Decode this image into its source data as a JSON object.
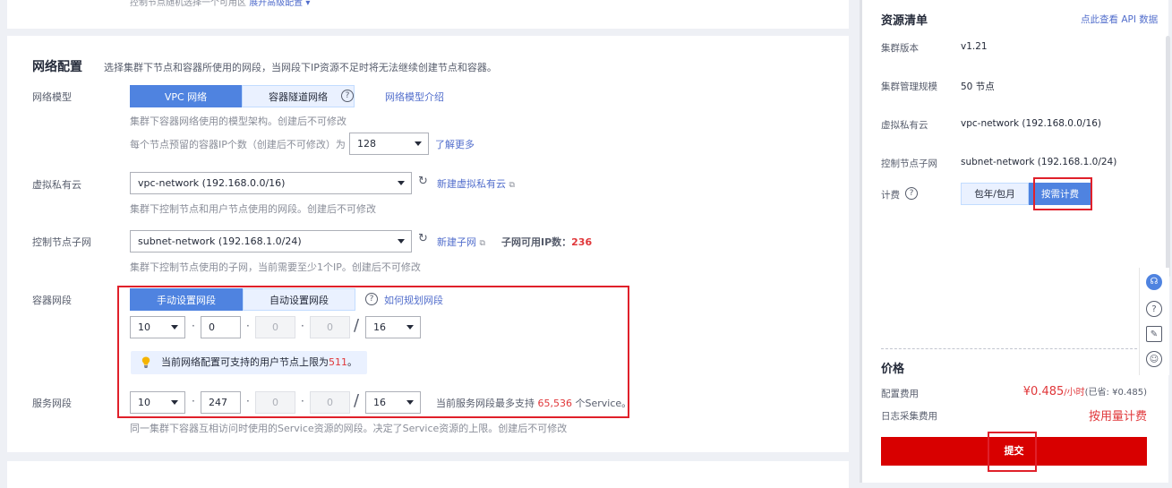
{
  "top": {
    "hint": "控制节点随机选择一个可用区",
    "advanced_link": "展开高级配置"
  },
  "network": {
    "title": "网络配置",
    "desc": "选择集群下节点和容器所使用的网段，当网段下IP资源不足时将无法继续创建节点和容器。",
    "model": {
      "label": "网络模型",
      "options": [
        "VPC 网络",
        "容器隧道网络"
      ],
      "selected": "VPC 网络",
      "help_link": "网络模型介绍",
      "help1": "集群下容器网络使用的模型架构。创建后不可修改",
      "help2": "每个节点预留的容器IP个数（创建后不可修改）为",
      "ip_count": "128",
      "more_link": "了解更多"
    },
    "vpc": {
      "label": "虚拟私有云",
      "value": "vpc-network (192.168.0.0/16)",
      "new_link": "新建虚拟私有云",
      "help": "集群下控制节点和用户节点使用的网段。创建后不可修改"
    },
    "subnet": {
      "label": "控制节点子网",
      "value": "subnet-network (192.168.1.0/24)",
      "new_link": "新建子网",
      "avail_label": "子网可用IP数：",
      "avail_value": "236",
      "help": "集群下控制节点使用的子网，当前需要至少1个IP。创建后不可修改"
    },
    "container_cidr": {
      "label": "容器网段",
      "options": [
        "手动设置网段",
        "自动设置网段"
      ],
      "selected": "手动设置网段",
      "help_link": "如何规划网段",
      "octets": [
        "10",
        "0",
        "0",
        "0"
      ],
      "mask": "16",
      "tip_prefix": "当前网络配置可支持的用户节点上限为",
      "tip_value": "511",
      "tip_suffix": "。"
    },
    "service_cidr": {
      "label": "服务网段",
      "octets": [
        "10",
        "247",
        "0",
        "0"
      ],
      "mask": "16",
      "note_prefix": "当前服务网段最多支持",
      "note_value": "65,536",
      "note_suffix": "个Service。",
      "help": "同一集群下容器互相访问时使用的Service资源的网段。决定了Service资源的上限。创建后不可修改"
    }
  },
  "resource": {
    "title": "资源清单",
    "api_link": "点此查看 API 数据",
    "rows": [
      {
        "k": "集群版本",
        "v": "v1.21"
      },
      {
        "k": "集群管理规模",
        "v": "50 节点"
      },
      {
        "k": "虚拟私有云",
        "v": "vpc-network (192.168.0.0/16)"
      },
      {
        "k": "控制节点子网",
        "v": "subnet-network (192.168.1.0/24)"
      }
    ],
    "billing_label": "计费",
    "billing_options": [
      "包年/包月",
      "按需计费"
    ],
    "billing_selected": "按需计费"
  },
  "price": {
    "title": "价格",
    "config_label": "配置费用",
    "config_value": "¥0.485",
    "config_unit": "/小时",
    "config_saved": "(已省: ¥0.485)",
    "log_label": "日志采集费用",
    "log_value": "按用量计费",
    "submit": "提交"
  },
  "colors": {
    "primary": "#4f83e0",
    "danger": "#d80000",
    "highlight_box": "#e0202a"
  }
}
